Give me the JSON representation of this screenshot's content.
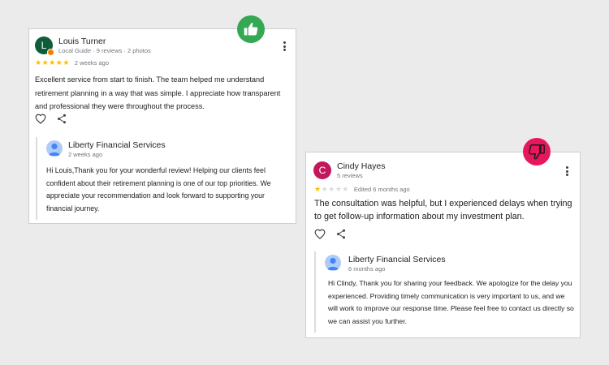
{
  "colors": {
    "positive_badge": "#34a853",
    "negative_badge": "#e8175d",
    "star_filled": "#fbbc04",
    "star_empty": "#dadce0",
    "avatar_louis": "#0f5c3a",
    "avatar_cindy": "#c2185b"
  },
  "positive_review": {
    "badge_icon": "thumbs-up-icon",
    "reviewer": {
      "initial": "L",
      "name": "Louis Turner",
      "meta": "Local Guide · 9 reviews · 2 photos"
    },
    "rating": 5,
    "time": "2 weeks ago",
    "text": "Excellent service from start to finish. The team helped me understand retirement planning in a way that was simple. I appreciate how transparent and professional they were throughout the process.",
    "reply": {
      "owner_name": "Liberty Financial Services",
      "time": "2 weeks ago",
      "text": "Hi Louis,Thank you for your wonderful review! Helping our clients feel confident about their retirement planning is one of our top priorities. We appreciate your recommendation and look forward to supporting your financial journey."
    }
  },
  "negative_review": {
    "badge_icon": "thumbs-down-icon",
    "reviewer": {
      "initial": "C",
      "name": "Cindy Hayes",
      "meta": "5 reviews"
    },
    "rating": 1,
    "time": "Edited 6 months ago",
    "text": "The consultation was helpful, but I experienced delays when trying to get follow-up information about my investment plan.",
    "reply": {
      "owner_name": "Liberty Financial Services",
      "time": "6 months ago",
      "text": "Hi Clindy, Thank you for sharing your feedback. We apologize for the delay you experienced. Providing timely communication is very important to us, and we will work to improve our response time. Please feel free to contact us directly so we can assist you further."
    }
  }
}
